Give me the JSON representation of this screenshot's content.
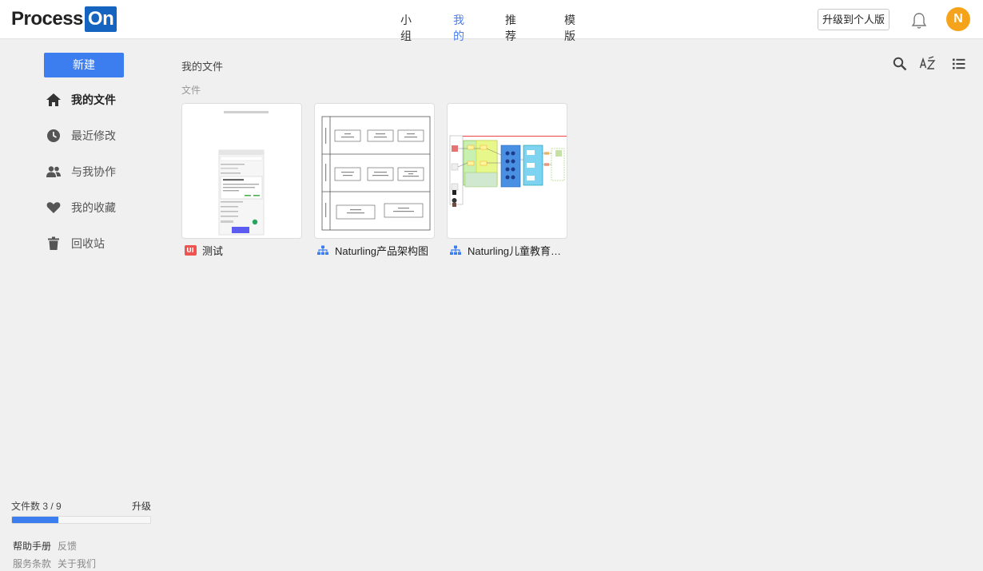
{
  "app": {
    "logo_part1": "Process",
    "logo_part2": "On",
    "accent_color": "#3c7ef0"
  },
  "topnav": {
    "items": [
      {
        "label": "小组",
        "active": false
      },
      {
        "label": "我的",
        "active": true
      },
      {
        "label": "推荐",
        "active": false
      },
      {
        "label": "模版",
        "active": false
      }
    ],
    "upgrade_label": "升级到个人版",
    "bell_icon": "bell-icon",
    "avatar_letter": "N"
  },
  "sidebar": {
    "new_label": "新建",
    "items": [
      {
        "label": "我的文件",
        "icon": "home-icon",
        "active": true
      },
      {
        "label": "最近修改",
        "icon": "clock-icon",
        "active": false
      },
      {
        "label": "与我协作",
        "icon": "people-icon",
        "active": false
      },
      {
        "label": "我的收藏",
        "icon": "heart-icon",
        "active": false
      },
      {
        "label": "回收站",
        "icon": "trash-icon",
        "active": false
      }
    ],
    "quota_label": "文件数 3 / 9",
    "quota_fraction": 0.333,
    "quota_upgrade": "升级",
    "footer": {
      "help": "帮助手册",
      "feedback": "反馈",
      "terms": "服务条款",
      "about": "关于我们"
    }
  },
  "main": {
    "breadcrumb": "我的文件",
    "section_title": "文件",
    "tools": [
      "search-icon",
      "sort-az-icon",
      "list-view-icon"
    ],
    "files": [
      {
        "name": "测试",
        "type": "ui",
        "badge": "UI"
      },
      {
        "name": "Naturling产品架构图",
        "type": "diagram"
      },
      {
        "name": "Naturling儿童教育…",
        "type": "diagram"
      }
    ]
  }
}
